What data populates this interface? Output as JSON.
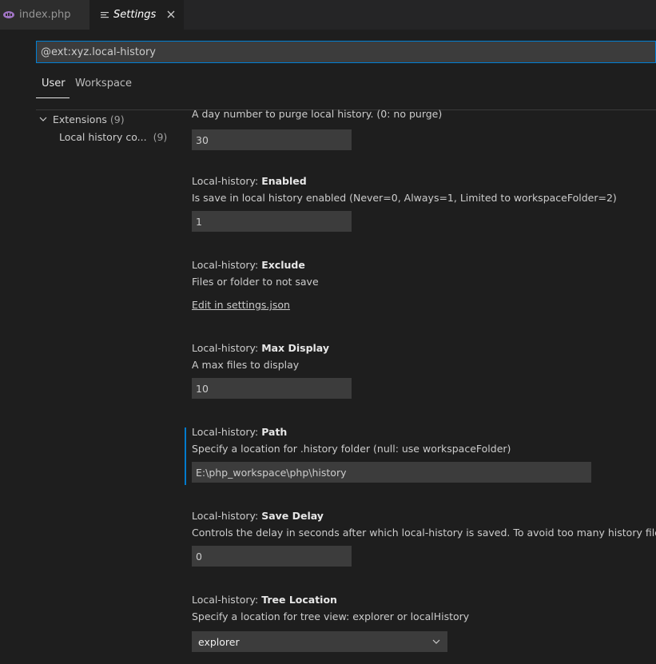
{
  "tabs": [
    {
      "label": "index.php",
      "icon": "php-icon"
    },
    {
      "label": "Settings",
      "icon": "settings-lines-icon"
    }
  ],
  "search": {
    "value": "@ext:xyz.local-history"
  },
  "scope": {
    "user": "User",
    "workspace": "Workspace"
  },
  "toc": {
    "extensions_label": "Extensions",
    "extensions_count": "(9)",
    "child_label": "Local history co...",
    "child_count": "(9)"
  },
  "settings": [
    {
      "category": "",
      "name": "",
      "description": "A day number to purge local history. (0: no purge)",
      "value": "30"
    },
    {
      "category": "Local-history: ",
      "name": "Enabled",
      "description": "Is save in local history enabled (Never=0, Always=1, Limited to workspaceFolder=2)",
      "value": "1"
    },
    {
      "category": "Local-history: ",
      "name": "Exclude",
      "description": "Files or folder to not save",
      "link": "Edit in settings.json"
    },
    {
      "category": "Local-history: ",
      "name": "Max Display",
      "description": "A max files to display",
      "value": "10"
    },
    {
      "category": "Local-history: ",
      "name": "Path",
      "description": "Specify a location for .history folder (null: use workspaceFolder)",
      "value": "E:\\php_workspace\\php\\history"
    },
    {
      "category": "Local-history: ",
      "name": "Save Delay",
      "description": "Controls the delay in seconds after which local-history is saved. To avoid too many history files.",
      "value": "0"
    },
    {
      "category": "Local-history: ",
      "name": "Tree Location",
      "description": "Specify a location for tree view: explorer or localHistory",
      "value": "explorer"
    }
  ],
  "colors": {
    "accent": "#007acc",
    "focus_border": "#007fd4",
    "input_bg": "#3c3c3c",
    "editor_bg": "#1e1e1e"
  }
}
